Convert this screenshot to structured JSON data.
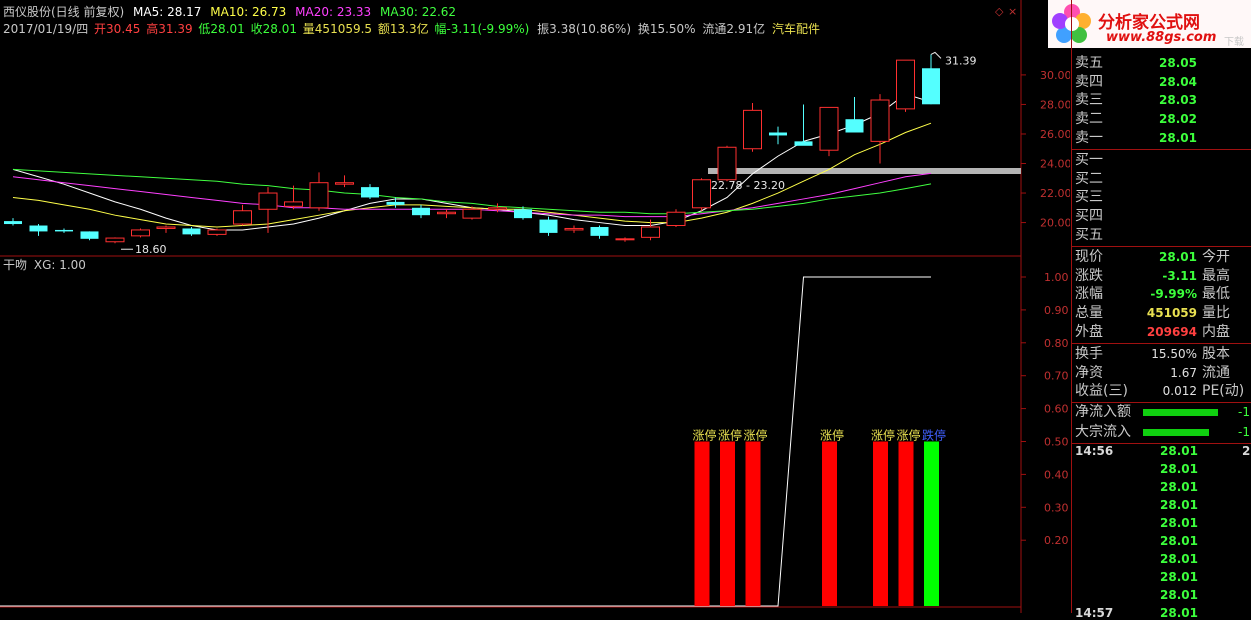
{
  "header": {
    "stock_name": "西仪股份(日线 前复权)",
    "ma5": "MA5: 28.17",
    "ma10": "MA10: 26.73",
    "ma20": "MA20: 23.33",
    "ma30": "MA30: 22.62",
    "date": "2017/01/19/四",
    "open": "开30.45",
    "high": "高31.39",
    "low": "低28.01",
    "close": "收28.01",
    "volume": "量451059.5",
    "amount": "额13.3亿",
    "change": "幅-3.11(-9.99%)",
    "amplitude": "振3.38(10.86%)",
    "turnover": "换15.50%",
    "float_shares": "流通2.91亿",
    "sector": "汽车配件"
  },
  "logo": {
    "title": "分析家公式网",
    "url": "www.88gs.com",
    "watermark": "下载"
  },
  "indicator_header": {
    "name": "干吻",
    "xg": "XG: 1.00"
  },
  "colors": {
    "up": "#ff3030",
    "down": "#54ffff",
    "ma5": "#ffffff",
    "ma10": "#ffff4a",
    "ma20": "#ff40ff",
    "ma30": "#40ff40",
    "grid": "#a01010",
    "limit_bar": "#ff0000",
    "limit_bar_last": "#00ff00"
  },
  "chart_data": [
    {
      "type": "candlestick",
      "title": "西仪股份(日线 前复权)",
      "y_ticks": [
        "20.00",
        "22.00",
        "24.00",
        "26.00",
        "28.00",
        "30.00"
      ],
      "ylim": [
        17.6,
        32.5
      ],
      "candles": [
        {
          "o": 20.1,
          "h": 20.3,
          "l": 19.8,
          "c": 19.9
        },
        {
          "o": 19.8,
          "h": 19.9,
          "l": 19.1,
          "c": 19.4
        },
        {
          "o": 19.5,
          "h": 19.6,
          "l": 19.3,
          "c": 19.4
        },
        {
          "o": 19.4,
          "h": 19.4,
          "l": 18.8,
          "c": 18.9
        },
        {
          "o": 18.7,
          "h": 19.0,
          "l": 18.6,
          "c": 18.95
        },
        {
          "o": 19.1,
          "h": 19.6,
          "l": 19.0,
          "c": 19.5
        },
        {
          "o": 19.6,
          "h": 19.8,
          "l": 19.3,
          "c": 19.7
        },
        {
          "o": 19.6,
          "h": 19.7,
          "l": 19.1,
          "c": 19.2
        },
        {
          "o": 19.2,
          "h": 19.6,
          "l": 19.1,
          "c": 19.5
        },
        {
          "o": 19.9,
          "h": 21.2,
          "l": 19.8,
          "c": 20.8
        },
        {
          "o": 20.9,
          "h": 22.4,
          "l": 19.3,
          "c": 22.0
        },
        {
          "o": 21.1,
          "h": 22.5,
          "l": 20.9,
          "c": 21.4
        },
        {
          "o": 21.0,
          "h": 23.4,
          "l": 20.8,
          "c": 22.7
        },
        {
          "o": 22.6,
          "h": 23.2,
          "l": 22.4,
          "c": 22.7
        },
        {
          "o": 22.4,
          "h": 22.6,
          "l": 21.6,
          "c": 21.7
        },
        {
          "o": 21.4,
          "h": 21.7,
          "l": 21.0,
          "c": 21.2
        },
        {
          "o": 21.0,
          "h": 21.2,
          "l": 20.3,
          "c": 20.5
        },
        {
          "o": 20.6,
          "h": 20.9,
          "l": 20.3,
          "c": 20.7
        },
        {
          "o": 20.3,
          "h": 21.1,
          "l": 20.2,
          "c": 20.9
        },
        {
          "o": 20.9,
          "h": 21.3,
          "l": 20.7,
          "c": 21.0
        },
        {
          "o": 20.9,
          "h": 21.1,
          "l": 20.2,
          "c": 20.3
        },
        {
          "o": 20.2,
          "h": 20.4,
          "l": 19.1,
          "c": 19.3
        },
        {
          "o": 19.5,
          "h": 19.8,
          "l": 19.3,
          "c": 19.6
        },
        {
          "o": 19.7,
          "h": 19.8,
          "l": 18.9,
          "c": 19.1
        },
        {
          "o": 18.9,
          "h": 19.0,
          "l": 18.7,
          "c": 18.9
        },
        {
          "o": 19.0,
          "h": 20.2,
          "l": 18.8,
          "c": 19.7
        },
        {
          "o": 19.8,
          "h": 20.9,
          "l": 19.7,
          "c": 20.7
        },
        {
          "o": 21.0,
          "h": 23.0,
          "l": 20.8,
          "c": 22.9
        },
        {
          "o": 22.9,
          "h": 25.2,
          "l": 22.8,
          "c": 25.1
        },
        {
          "o": 25.0,
          "h": 28.1,
          "l": 24.8,
          "c": 27.6
        },
        {
          "o": 26.1,
          "h": 26.5,
          "l": 25.3,
          "c": 25.9
        },
        {
          "o": 25.5,
          "h": 28.0,
          "l": 25.4,
          "c": 25.2
        },
        {
          "o": 24.9,
          "h": 27.8,
          "l": 24.5,
          "c": 27.8
        },
        {
          "o": 27.0,
          "h": 28.5,
          "l": 26.1,
          "c": 26.1
        },
        {
          "o": 25.5,
          "h": 28.7,
          "l": 24.0,
          "c": 28.3
        },
        {
          "o": 27.7,
          "h": 31.0,
          "l": 27.5,
          "c": 31.0
        },
        {
          "o": 30.45,
          "h": 31.39,
          "l": 28.01,
          "c": 28.01
        }
      ],
      "ma": [
        {
          "name": "MA5",
          "values": [
            23.6,
            23.1,
            22.6,
            22.0,
            21.4,
            20.9,
            20.3,
            19.8,
            19.5,
            19.5,
            19.7,
            19.9,
            20.3,
            20.8,
            21.3,
            21.6,
            21.6,
            21.3,
            21.0,
            20.9,
            20.7,
            20.5,
            20.2,
            20.0,
            19.8,
            19.8,
            20.1,
            20.8,
            21.7,
            23.3,
            24.5,
            25.5,
            26.0,
            26.6,
            27.4,
            28.7,
            28.17
          ]
        },
        {
          "name": "MA10",
          "values": [
            21.7,
            21.5,
            21.2,
            20.9,
            20.5,
            20.2,
            19.9,
            19.8,
            19.7,
            19.8,
            19.9,
            20.2,
            20.5,
            20.8,
            21.0,
            21.2,
            21.2,
            21.1,
            21.0,
            20.9,
            20.9,
            20.7,
            20.5,
            20.3,
            20.1,
            20.0,
            20.0,
            20.3,
            20.7,
            21.3,
            22.0,
            22.8,
            23.6,
            24.6,
            25.3,
            26.1,
            26.73
          ]
        },
        {
          "name": "MA20",
          "values": [
            23.1,
            22.9,
            22.7,
            22.5,
            22.3,
            22.1,
            21.9,
            21.7,
            21.5,
            21.3,
            21.2,
            21.0,
            21.0,
            20.9,
            20.9,
            20.9,
            20.9,
            20.9,
            20.9,
            20.8,
            20.7,
            20.6,
            20.5,
            20.5,
            20.4,
            20.4,
            20.4,
            20.6,
            20.8,
            21.0,
            21.3,
            21.6,
            21.9,
            22.3,
            22.7,
            23.1,
            23.33
          ]
        },
        {
          "name": "MA30",
          "values": [
            23.6,
            23.5,
            23.4,
            23.3,
            23.2,
            23.1,
            23.0,
            22.9,
            22.8,
            22.6,
            22.5,
            22.3,
            22.2,
            22.0,
            21.9,
            21.7,
            21.6,
            21.4,
            21.3,
            21.1,
            21.0,
            20.9,
            20.8,
            20.7,
            20.7,
            20.6,
            20.6,
            20.7,
            20.8,
            20.9,
            21.1,
            21.3,
            21.6,
            21.8,
            22.0,
            22.3,
            22.62
          ]
        }
      ],
      "annotations": {
        "high_label": "31.39",
        "low_label": "18.60",
        "range_label": "22.78 - 23.20"
      }
    },
    {
      "type": "bar",
      "title": "干吻",
      "y_ticks": [
        "0.20",
        "0.30",
        "0.40",
        "0.50",
        "0.60",
        "0.70",
        "0.80",
        "0.90",
        "1.00"
      ],
      "ylim": [
        0.0,
        1.0
      ],
      "signal_line": [
        0,
        0,
        0,
        0,
        0,
        0,
        0,
        0,
        0,
        0,
        0,
        0,
        0,
        0,
        0,
        0,
        0,
        0,
        0,
        0,
        0,
        0,
        0,
        0,
        0,
        0,
        0,
        0,
        0,
        0,
        0,
        1,
        1,
        1,
        1,
        1,
        1
      ],
      "limit_bars": [
        {
          "index": 27,
          "value": 0.5,
          "label": "涨停"
        },
        {
          "index": 28,
          "value": 0.5,
          "label": "涨停"
        },
        {
          "index": 29,
          "value": 0.5,
          "label": "涨停"
        },
        {
          "index": 32,
          "value": 0.5,
          "label": "涨停"
        },
        {
          "index": 34,
          "value": 0.5,
          "label": "涨停"
        },
        {
          "index": 35,
          "value": 0.5,
          "label": "涨停"
        },
        {
          "index": 36,
          "value": 0.5,
          "label": "跌停"
        }
      ]
    }
  ],
  "quote": {
    "sell": [
      {
        "label": "卖五",
        "price": "28.05"
      },
      {
        "label": "卖四",
        "price": "28.04"
      },
      {
        "label": "卖三",
        "price": "28.03"
      },
      {
        "label": "卖二",
        "price": "28.02"
      },
      {
        "label": "卖一",
        "price": "28.01"
      }
    ],
    "buy": [
      {
        "label": "买一"
      },
      {
        "label": "买二"
      },
      {
        "label": "买三"
      },
      {
        "label": "买四"
      },
      {
        "label": "买五"
      }
    ],
    "stats": [
      {
        "label": "现价",
        "value": "28.01",
        "extra": "今开",
        "color": "#3cff3c"
      },
      {
        "label": "涨跌",
        "value": "-3.11",
        "extra": "最高",
        "color": "#3cff3c"
      },
      {
        "label": "涨幅",
        "value": "-9.99%",
        "extra": "最低",
        "color": "#3cff3c"
      },
      {
        "label": "总量",
        "value": "451059",
        "extra": "量比",
        "color": "#e8e050"
      },
      {
        "label": "外盘",
        "value": "209694",
        "extra": "内盘",
        "color": "#ff4040"
      }
    ],
    "stats2": [
      {
        "label": "换手",
        "value": "15.50%",
        "extra": "股本",
        "color": "#e0e0e0"
      },
      {
        "label": "净资",
        "value": "1.67",
        "extra": "流通",
        "color": "#e0e0e0"
      },
      {
        "label": "收益(三)",
        "value": "0.012",
        "extra": "PE(动)",
        "color": "#e0e0e0"
      }
    ],
    "flow": [
      {
        "label": "净流入额",
        "value": "-1",
        "level": 0.85
      },
      {
        "label": "大宗流入",
        "value": "-1",
        "level": 0.75
      }
    ],
    "ticks": [
      {
        "time": "14:56",
        "price": "28.01"
      },
      {
        "time": "",
        "price": "28.01"
      },
      {
        "time": "",
        "price": "28.01"
      },
      {
        "time": "",
        "price": "28.01"
      },
      {
        "time": "",
        "price": "28.01"
      },
      {
        "time": "",
        "price": "28.01"
      },
      {
        "time": "",
        "price": "28.01"
      },
      {
        "time": "",
        "price": "28.01"
      },
      {
        "time": "",
        "price": "28.01"
      },
      {
        "time": "14:57",
        "price": "28.01"
      }
    ],
    "tick_right": "2"
  }
}
